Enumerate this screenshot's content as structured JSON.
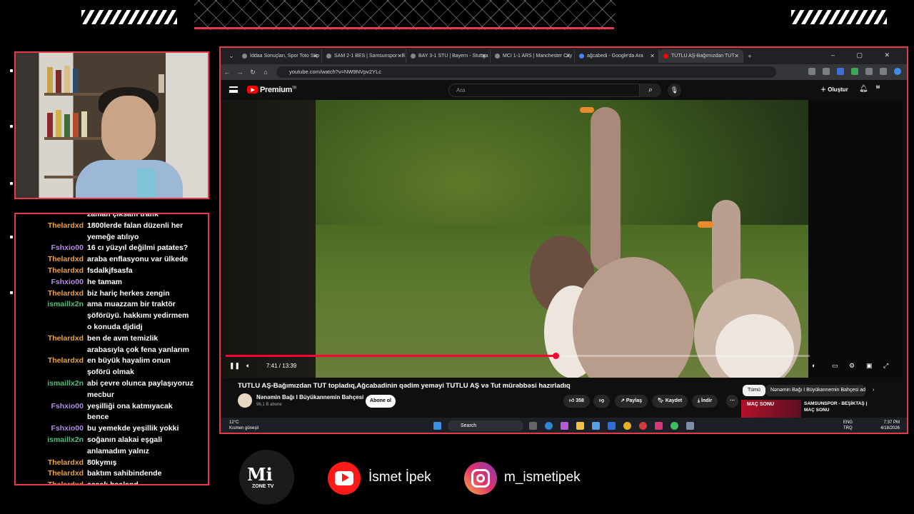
{
  "chat": [
    {
      "user": "",
      "msg": "zaman çıksam trafik",
      "color": "orange"
    },
    {
      "user": "Thelardxd",
      "msg": "1800lerde falan düzenli her yemeğe atılıyo",
      "color": "orange"
    },
    {
      "user": "Fshxio00",
      "msg": "16 cı yüzyıl değilmi patates?",
      "color": "purple"
    },
    {
      "user": "Thelardxd",
      "msg": "araba enflasyonu var ülkede",
      "color": "orange"
    },
    {
      "user": "Thelardxd",
      "msg": "fsdalkjfsasfa",
      "color": "orange"
    },
    {
      "user": "Fshxio00",
      "msg": "he tamam",
      "color": "purple"
    },
    {
      "user": "Thelardxd",
      "msg": "biz hariç herkes zengin",
      "color": "orange"
    },
    {
      "user": "ismaillx2n",
      "msg": "ama muazzam bir traktör şöförüyü. hakkımı yedirmem o konuda djdidj",
      "color": "green"
    },
    {
      "user": "Thelardxd",
      "msg": "ben de avm temizlik arabasıyla çok fena yanlarım",
      "color": "orange"
    },
    {
      "user": "Thelardxd",
      "msg": "en büyük hayalim onun şoförü olmak",
      "color": "orange"
    },
    {
      "user": "ismaillx2n",
      "msg": "abi çevre olunca paylaşıyoruz mecbur",
      "color": "green"
    },
    {
      "user": "Fshxio00",
      "msg": "yeşilliği ona katmıyacak bence",
      "color": "purple"
    },
    {
      "user": "Fshxio00",
      "msg": "bu yemekde yeşillik yokki",
      "color": "purple"
    },
    {
      "user": "ismaillx2n",
      "msg": "soğanın alakai eşgali anlamadım yalnız",
      "color": "green"
    },
    {
      "user": "Thelardxd",
      "msg": "80kymış",
      "color": "orange"
    },
    {
      "user": "Thelardxd",
      "msg": "baktım sahibindende",
      "color": "orange"
    },
    {
      "user": "Thelardxd",
      "msg": "eşşek haaland",
      "color": "orange"
    }
  ],
  "browser": {
    "tabs": [
      "İddaa Sonuçları, Spor Toto Süp",
      "SAM 2-1 BES | Samsunspor - B",
      "BAY 3-1 STU | Bayern - Stuttga",
      "MCI 1-1 ARS | Manchester City",
      "ağcabedi - Google'da Ara",
      "TUTLU AŞ-Bağımızdan TUT"
    ],
    "url": "youtube.com/watch?v=NW9NVpv2YLc",
    "new_tab": "+",
    "window_controls": "– ▢ ✕"
  },
  "youtube": {
    "brand": "Premium",
    "brand_sup": "TR",
    "search_placeholder": "Ara",
    "create_label": "Oluştur",
    "avatar_text": "M",
    "time": "7:41 / 13:39",
    "progress": 0.565,
    "title": "TUTLU AŞ-Bağımızdan TUT topladıq,Ağcabadinin qədim yeməyi TUTLU AŞ və Tut mürəbbəsi hazırladıq",
    "channel": "Nənəmin Bağı I Büyükannemin Bahçesi",
    "subs": "96,1 B abone",
    "subscribe": "Abone ol",
    "likes": "358",
    "share": "Paylaş",
    "save": "Kaydet",
    "download": "İndir",
    "chip_all": "Tümü",
    "chip_channel": "Nənəmin Bağı I Büyükannemin Bahçesi ad",
    "rec_thumb": "MAÇ SONU",
    "rec_title": "SAMSUNSPOR - BEŞİKTAŞ | MAÇ SONU"
  },
  "taskbar": {
    "temp": "12°C",
    "weather": "Kısmen güneşli",
    "search": "Search",
    "lang1": "ENG",
    "lang2": "TRQ",
    "clock": "7:37 PM",
    "date": "4/18/2026"
  },
  "social": {
    "logo": "Mi",
    "logo_sub": "ZONE TV",
    "youtube_name": "İsmet İpek",
    "instagram_name": "m_ismetipek"
  },
  "colors": {
    "accent": "#e5394c",
    "youtube_red": "#ff0000"
  }
}
